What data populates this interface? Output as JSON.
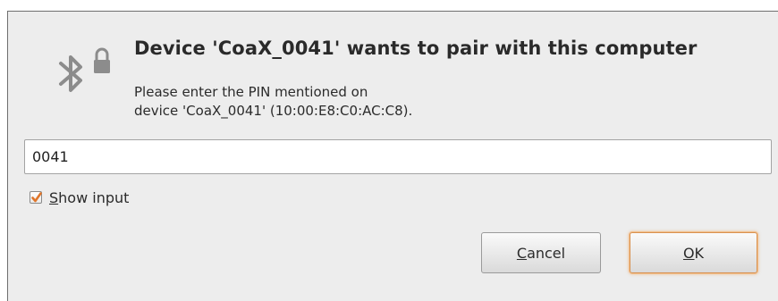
{
  "dialog": {
    "title": "Device 'CoaX_0041' wants to pair with this computer",
    "message_line1": "Please enter the PIN mentioned on",
    "message_line2": "device 'CoaX_0041' (10:00:E8:C0:AC:C8).",
    "icon": "bluetooth-lock-icon"
  },
  "pin": {
    "value": "0041"
  },
  "show_input": {
    "checked": true,
    "mnemonic": "S",
    "rest": "how input",
    "label": "Show input"
  },
  "buttons": {
    "cancel": {
      "mnemonic": "C",
      "rest": "ancel",
      "label": "Cancel"
    },
    "ok": {
      "mnemonic": "O",
      "rest": "K",
      "label": "OK"
    }
  },
  "colors": {
    "background": "#ededed",
    "checkbox_accent": "#e0762b",
    "default_button_glow": "#f1c08e"
  }
}
